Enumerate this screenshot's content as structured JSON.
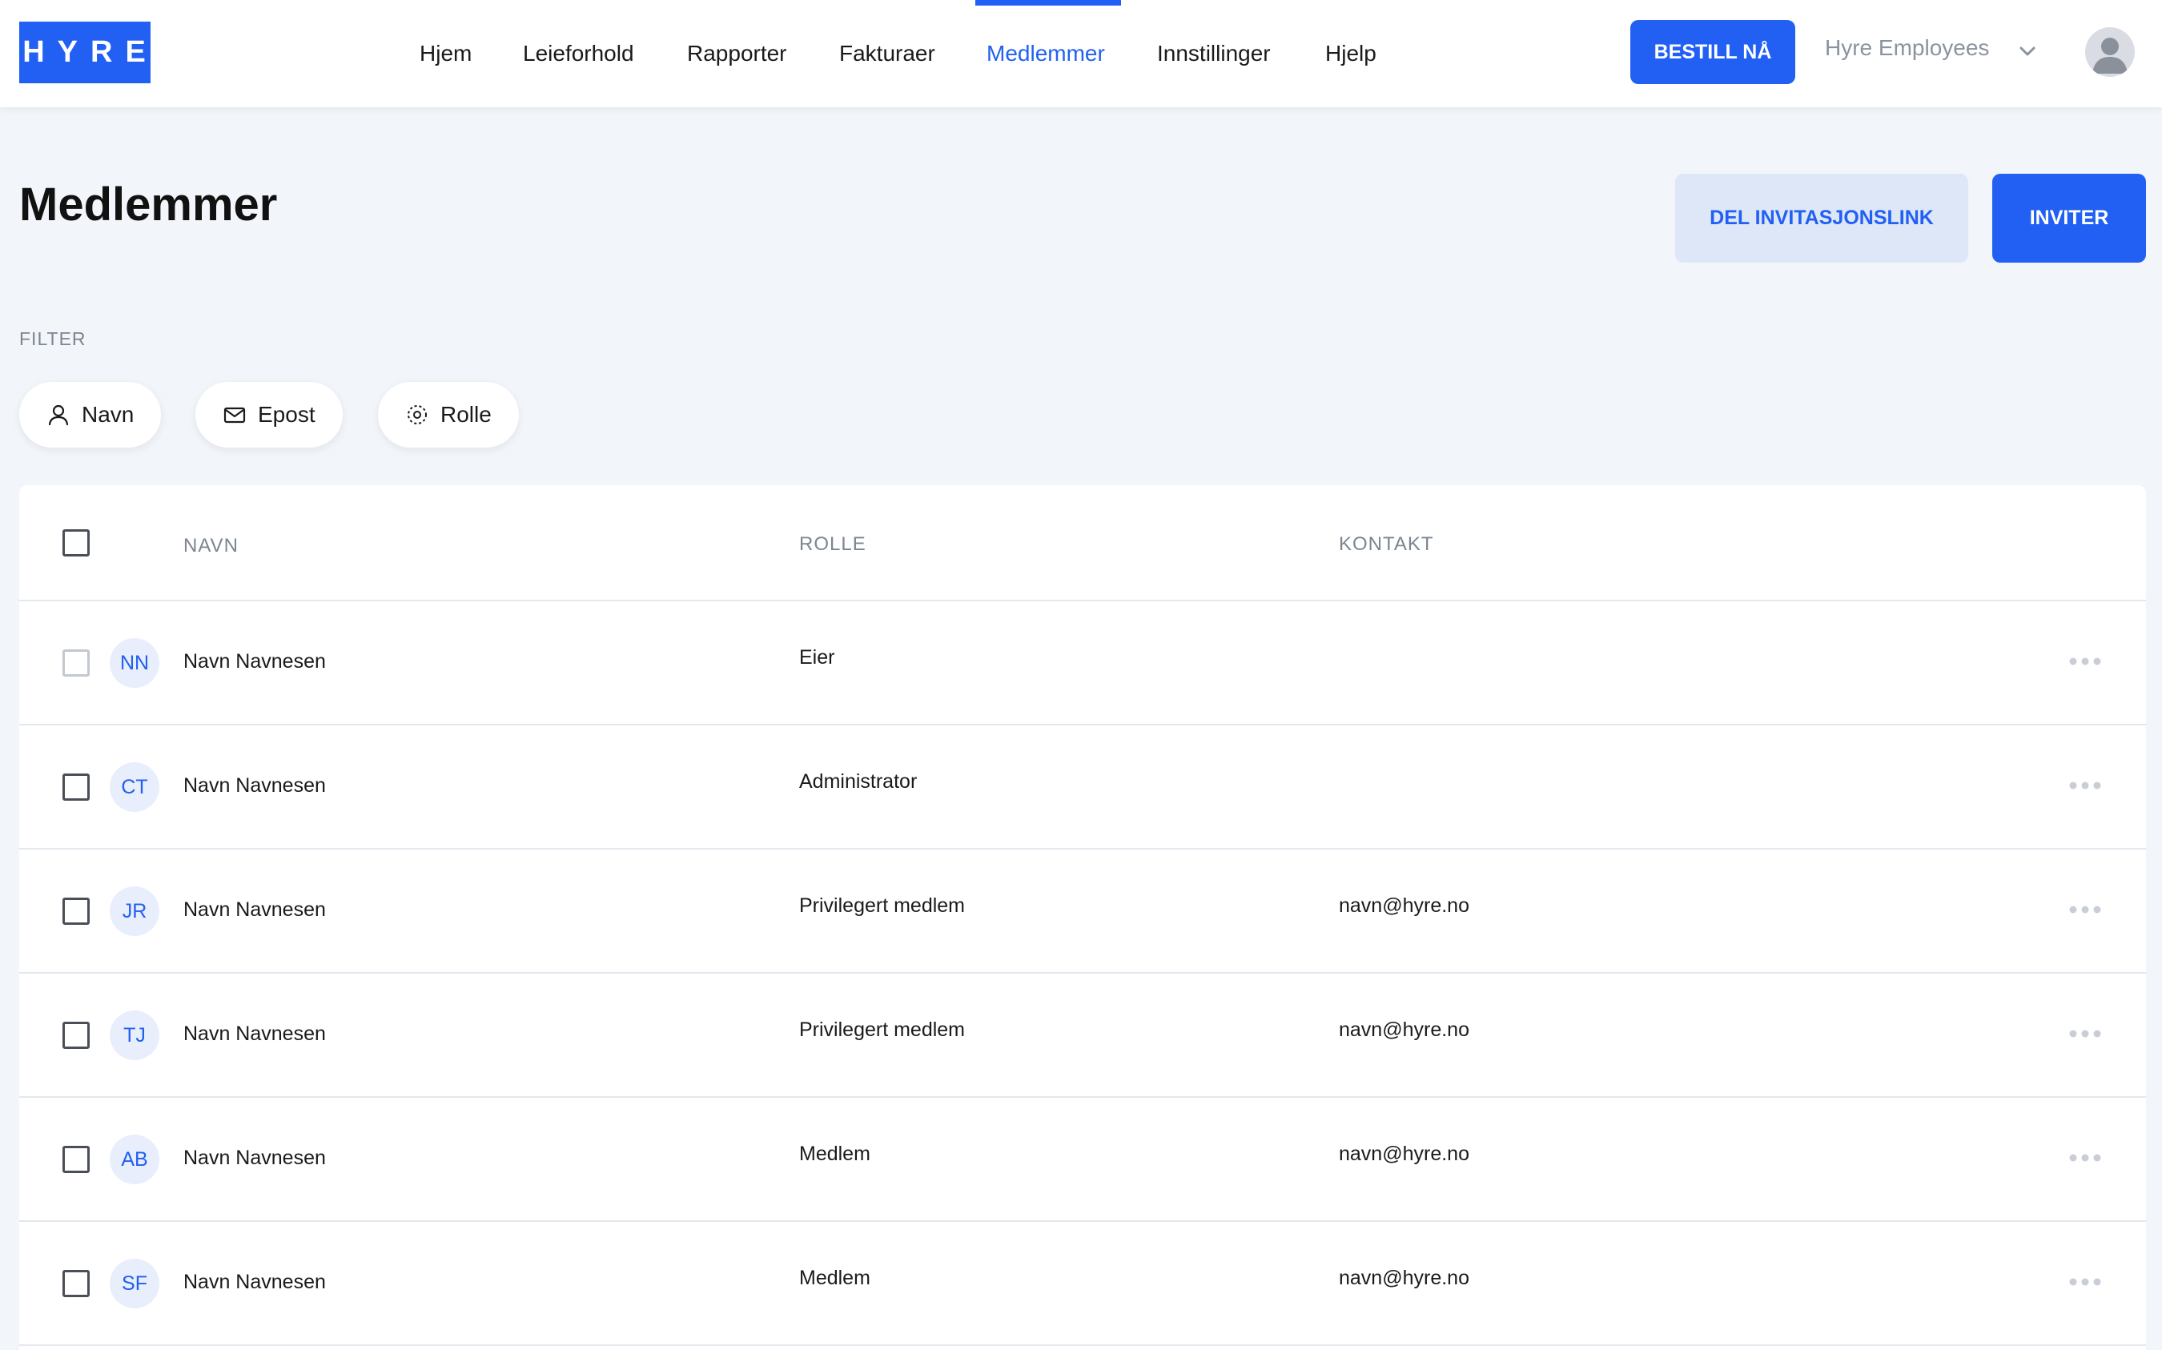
{
  "header": {
    "logo_text": "HYRE",
    "nav": [
      {
        "label": "Hjem"
      },
      {
        "label": "Leieforhold"
      },
      {
        "label": "Rapporter"
      },
      {
        "label": "Fakturaer"
      },
      {
        "label": "Medlemmer",
        "active": true
      },
      {
        "label": "Innstillinger"
      },
      {
        "label": "Hjelp"
      }
    ],
    "order_button": "BESTILL NÅ",
    "company": "Hyre Employees"
  },
  "page": {
    "title": "Medlemmer",
    "share_button": "DEL INVITASJONSLINK",
    "invite_button": "INVITER"
  },
  "filter": {
    "label": "FILTER",
    "chips": [
      {
        "label": "Navn",
        "icon": "person-icon"
      },
      {
        "label": "Epost",
        "icon": "envelope-icon"
      },
      {
        "label": "Rolle",
        "icon": "role-icon"
      }
    ]
  },
  "table": {
    "columns": [
      "NAVN",
      "ROLLE",
      "KONTAKT"
    ],
    "rows": [
      {
        "initials": "NN",
        "name": "Navn Navnesen",
        "role": "Eier",
        "contact": "",
        "checkbox_disabled": true
      },
      {
        "initials": "CT",
        "name": "Navn Navnesen",
        "role": "Administrator",
        "contact": ""
      },
      {
        "initials": "JR",
        "name": "Navn Navnesen",
        "role": "Privilegert medlem",
        "contact": "navn@hyre.no"
      },
      {
        "initials": "TJ",
        "name": "Navn Navnesen",
        "role": "Privilegert medlem",
        "contact": "navn@hyre.no"
      },
      {
        "initials": "AB",
        "name": "Navn Navnesen",
        "role": "Medlem",
        "contact": "navn@hyre.no"
      },
      {
        "initials": "SF",
        "name": "Navn Navnesen",
        "role": "Medlem",
        "contact": "navn@hyre.no"
      }
    ]
  },
  "colors": {
    "accent": "#2160f3",
    "background": "#f2f5f9",
    "muted_text": "#7c8591"
  }
}
